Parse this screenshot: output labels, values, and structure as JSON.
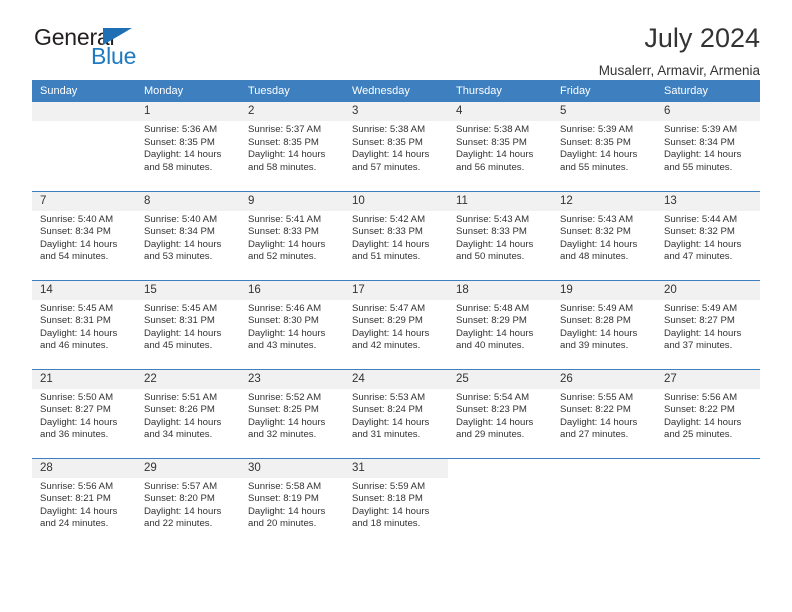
{
  "logo": {
    "word_top": "General",
    "word_bottom": "Blue",
    "triangle_color": "#1f6fb5",
    "blue_color": "#1f7ac0"
  },
  "header": {
    "title": "July 2024",
    "location": "Musalerr, Armavir, Armenia"
  },
  "theme": {
    "header_blue": "#3d7fbf",
    "daynum_background": "#f1f1f1",
    "text_color": "#333333"
  },
  "calendar": {
    "weekday_headers": [
      "Sunday",
      "Monday",
      "Tuesday",
      "Wednesday",
      "Thursday",
      "Friday",
      "Saturday"
    ],
    "weeks": [
      [
        {
          "day": "",
          "empty": true
        },
        {
          "day": "1",
          "sunrise": "Sunrise: 5:36 AM",
          "sunset": "Sunset: 8:35 PM",
          "daylight1": "Daylight: 14 hours",
          "daylight2": "and 58 minutes."
        },
        {
          "day": "2",
          "sunrise": "Sunrise: 5:37 AM",
          "sunset": "Sunset: 8:35 PM",
          "daylight1": "Daylight: 14 hours",
          "daylight2": "and 58 minutes."
        },
        {
          "day": "3",
          "sunrise": "Sunrise: 5:38 AM",
          "sunset": "Sunset: 8:35 PM",
          "daylight1": "Daylight: 14 hours",
          "daylight2": "and 57 minutes."
        },
        {
          "day": "4",
          "sunrise": "Sunrise: 5:38 AM",
          "sunset": "Sunset: 8:35 PM",
          "daylight1": "Daylight: 14 hours",
          "daylight2": "and 56 minutes."
        },
        {
          "day": "5",
          "sunrise": "Sunrise: 5:39 AM",
          "sunset": "Sunset: 8:35 PM",
          "daylight1": "Daylight: 14 hours",
          "daylight2": "and 55 minutes."
        },
        {
          "day": "6",
          "sunrise": "Sunrise: 5:39 AM",
          "sunset": "Sunset: 8:34 PM",
          "daylight1": "Daylight: 14 hours",
          "daylight2": "and 55 minutes."
        }
      ],
      [
        {
          "day": "7",
          "sunrise": "Sunrise: 5:40 AM",
          "sunset": "Sunset: 8:34 PM",
          "daylight1": "Daylight: 14 hours",
          "daylight2": "and 54 minutes."
        },
        {
          "day": "8",
          "sunrise": "Sunrise: 5:40 AM",
          "sunset": "Sunset: 8:34 PM",
          "daylight1": "Daylight: 14 hours",
          "daylight2": "and 53 minutes."
        },
        {
          "day": "9",
          "sunrise": "Sunrise: 5:41 AM",
          "sunset": "Sunset: 8:33 PM",
          "daylight1": "Daylight: 14 hours",
          "daylight2": "and 52 minutes."
        },
        {
          "day": "10",
          "sunrise": "Sunrise: 5:42 AM",
          "sunset": "Sunset: 8:33 PM",
          "daylight1": "Daylight: 14 hours",
          "daylight2": "and 51 minutes."
        },
        {
          "day": "11",
          "sunrise": "Sunrise: 5:43 AM",
          "sunset": "Sunset: 8:33 PM",
          "daylight1": "Daylight: 14 hours",
          "daylight2": "and 50 minutes."
        },
        {
          "day": "12",
          "sunrise": "Sunrise: 5:43 AM",
          "sunset": "Sunset: 8:32 PM",
          "daylight1": "Daylight: 14 hours",
          "daylight2": "and 48 minutes."
        },
        {
          "day": "13",
          "sunrise": "Sunrise: 5:44 AM",
          "sunset": "Sunset: 8:32 PM",
          "daylight1": "Daylight: 14 hours",
          "daylight2": "and 47 minutes."
        }
      ],
      [
        {
          "day": "14",
          "sunrise": "Sunrise: 5:45 AM",
          "sunset": "Sunset: 8:31 PM",
          "daylight1": "Daylight: 14 hours",
          "daylight2": "and 46 minutes."
        },
        {
          "day": "15",
          "sunrise": "Sunrise: 5:45 AM",
          "sunset": "Sunset: 8:31 PM",
          "daylight1": "Daylight: 14 hours",
          "daylight2": "and 45 minutes."
        },
        {
          "day": "16",
          "sunrise": "Sunrise: 5:46 AM",
          "sunset": "Sunset: 8:30 PM",
          "daylight1": "Daylight: 14 hours",
          "daylight2": "and 43 minutes."
        },
        {
          "day": "17",
          "sunrise": "Sunrise: 5:47 AM",
          "sunset": "Sunset: 8:29 PM",
          "daylight1": "Daylight: 14 hours",
          "daylight2": "and 42 minutes."
        },
        {
          "day": "18",
          "sunrise": "Sunrise: 5:48 AM",
          "sunset": "Sunset: 8:29 PM",
          "daylight1": "Daylight: 14 hours",
          "daylight2": "and 40 minutes."
        },
        {
          "day": "19",
          "sunrise": "Sunrise: 5:49 AM",
          "sunset": "Sunset: 8:28 PM",
          "daylight1": "Daylight: 14 hours",
          "daylight2": "and 39 minutes."
        },
        {
          "day": "20",
          "sunrise": "Sunrise: 5:49 AM",
          "sunset": "Sunset: 8:27 PM",
          "daylight1": "Daylight: 14 hours",
          "daylight2": "and 37 minutes."
        }
      ],
      [
        {
          "day": "21",
          "sunrise": "Sunrise: 5:50 AM",
          "sunset": "Sunset: 8:27 PM",
          "daylight1": "Daylight: 14 hours",
          "daylight2": "and 36 minutes."
        },
        {
          "day": "22",
          "sunrise": "Sunrise: 5:51 AM",
          "sunset": "Sunset: 8:26 PM",
          "daylight1": "Daylight: 14 hours",
          "daylight2": "and 34 minutes."
        },
        {
          "day": "23",
          "sunrise": "Sunrise: 5:52 AM",
          "sunset": "Sunset: 8:25 PM",
          "daylight1": "Daylight: 14 hours",
          "daylight2": "and 32 minutes."
        },
        {
          "day": "24",
          "sunrise": "Sunrise: 5:53 AM",
          "sunset": "Sunset: 8:24 PM",
          "daylight1": "Daylight: 14 hours",
          "daylight2": "and 31 minutes."
        },
        {
          "day": "25",
          "sunrise": "Sunrise: 5:54 AM",
          "sunset": "Sunset: 8:23 PM",
          "daylight1": "Daylight: 14 hours",
          "daylight2": "and 29 minutes."
        },
        {
          "day": "26",
          "sunrise": "Sunrise: 5:55 AM",
          "sunset": "Sunset: 8:22 PM",
          "daylight1": "Daylight: 14 hours",
          "daylight2": "and 27 minutes."
        },
        {
          "day": "27",
          "sunrise": "Sunrise: 5:56 AM",
          "sunset": "Sunset: 8:22 PM",
          "daylight1": "Daylight: 14 hours",
          "daylight2": "and 25 minutes."
        }
      ],
      [
        {
          "day": "28",
          "sunrise": "Sunrise: 5:56 AM",
          "sunset": "Sunset: 8:21 PM",
          "daylight1": "Daylight: 14 hours",
          "daylight2": "and 24 minutes."
        },
        {
          "day": "29",
          "sunrise": "Sunrise: 5:57 AM",
          "sunset": "Sunset: 8:20 PM",
          "daylight1": "Daylight: 14 hours",
          "daylight2": "and 22 minutes."
        },
        {
          "day": "30",
          "sunrise": "Sunrise: 5:58 AM",
          "sunset": "Sunset: 8:19 PM",
          "daylight1": "Daylight: 14 hours",
          "daylight2": "and 20 minutes."
        },
        {
          "day": "31",
          "sunrise": "Sunrise: 5:59 AM",
          "sunset": "Sunset: 8:18 PM",
          "daylight1": "Daylight: 14 hours",
          "daylight2": "and 18 minutes."
        },
        {
          "day": "",
          "blank": true
        },
        {
          "day": "",
          "blank": true
        },
        {
          "day": "",
          "blank": true
        }
      ]
    ]
  }
}
